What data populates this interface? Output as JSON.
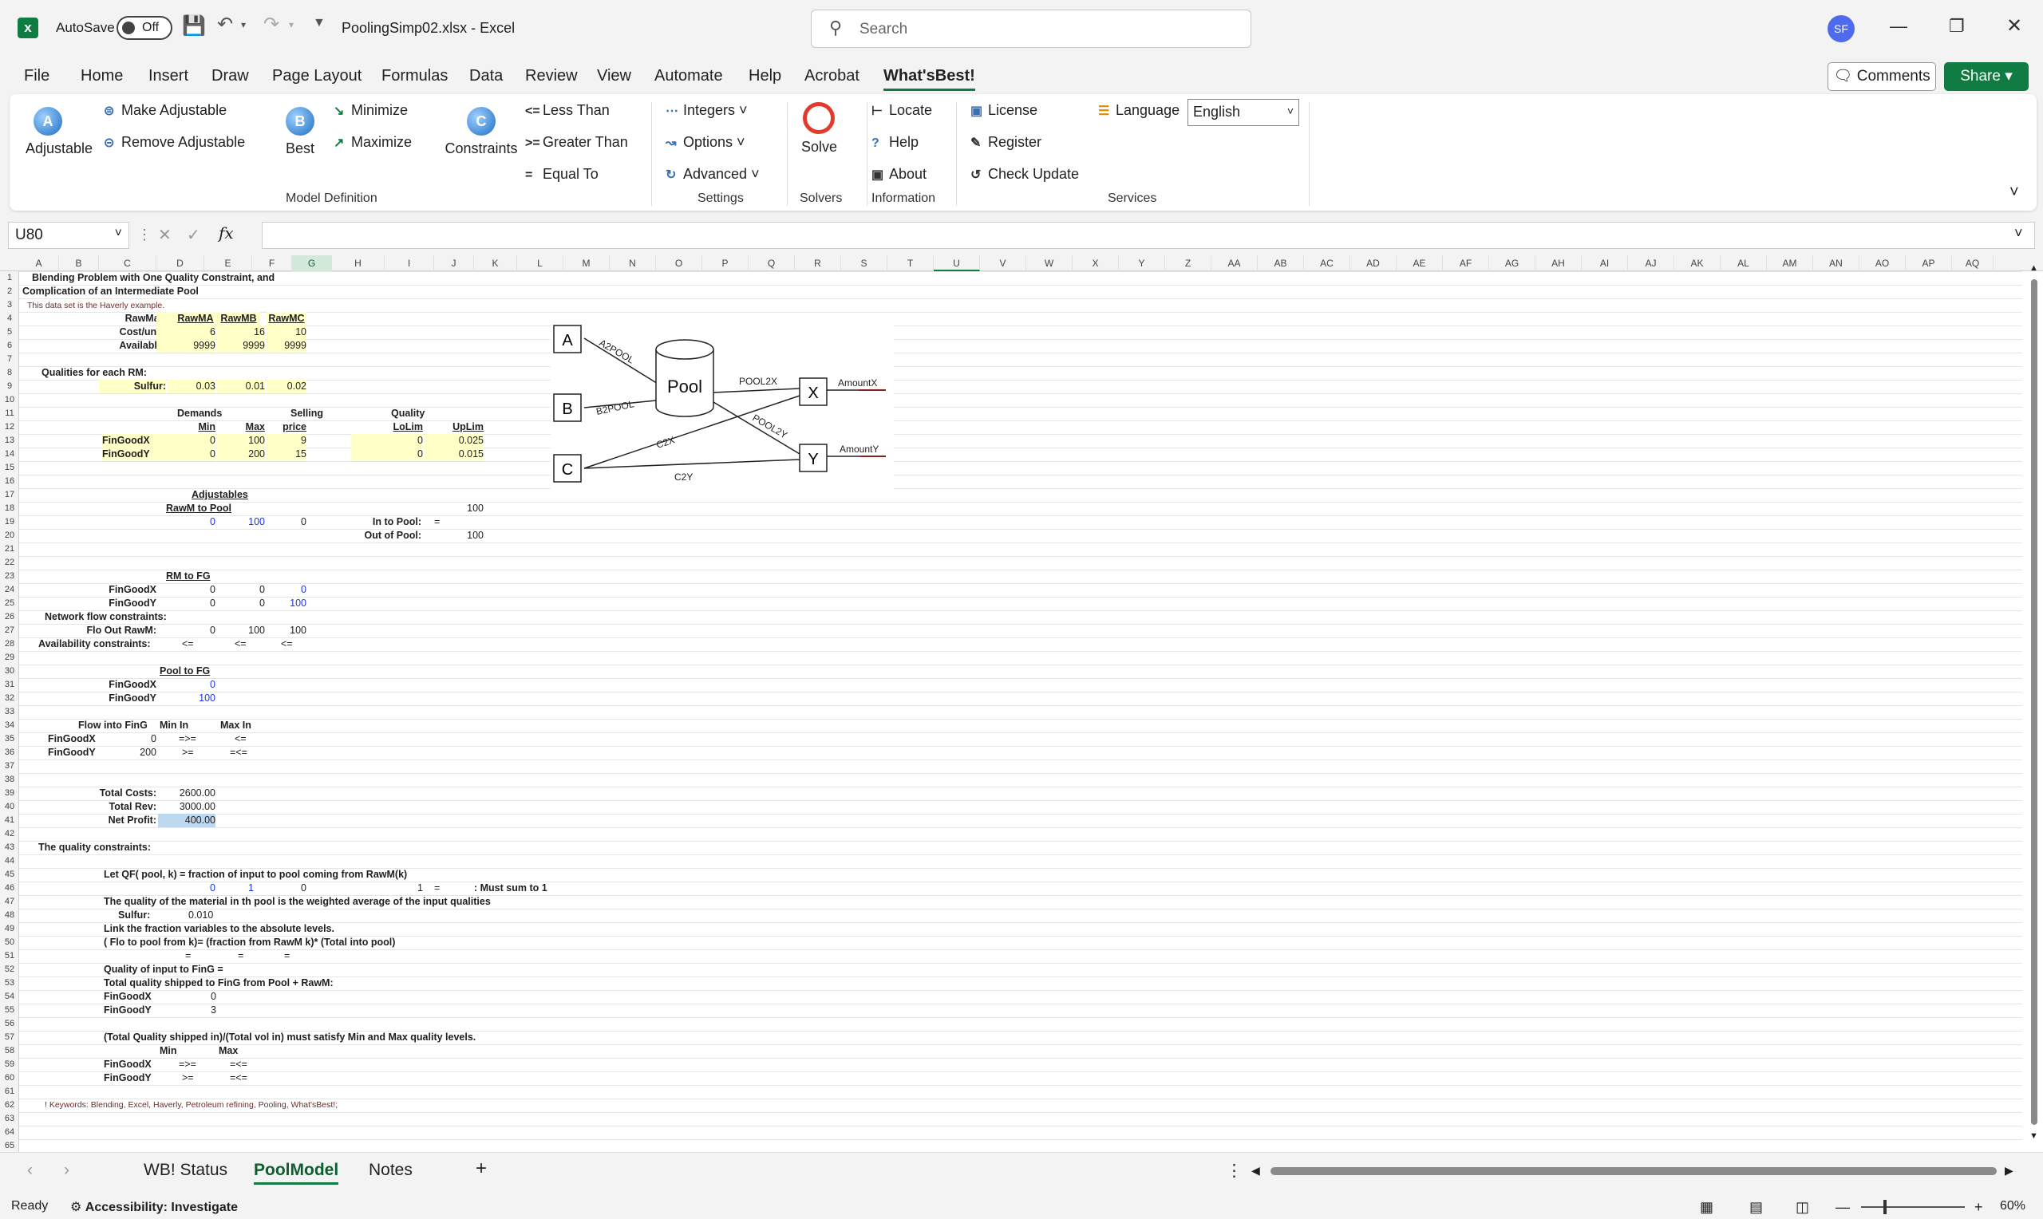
{
  "titlebar": {
    "autosave_label": "AutoSave",
    "autosave_state": "Off",
    "filename": "PoolingSimp02.xlsx  -  Excel",
    "search_placeholder": "Search",
    "user_initials": "SF"
  },
  "menu": [
    "File",
    "Home",
    "Insert",
    "Draw",
    "Page Layout",
    "Formulas",
    "Data",
    "Review",
    "View",
    "Automate",
    "Help",
    "Acrobat",
    "What'sBest!"
  ],
  "menu_active": "What'sBest!",
  "comments_label": "Comments",
  "share_label": "Share",
  "ribbon": {
    "adjustable": "Adjustable",
    "make_adjustable": "Make Adjustable",
    "remove_adjustable": "Remove Adjustable",
    "best": "Best",
    "minimize": "Minimize",
    "maximize": "Maximize",
    "constraints": "Constraints",
    "less_than": "Less Than",
    "greater_than": "Greater Than",
    "equal_to": "Equal To",
    "group_model": "Model Definition",
    "integers": "Integers",
    "options": "Options",
    "advanced": "Advanced",
    "group_settings": "Settings",
    "solve": "Solve",
    "group_solvers": "Solvers",
    "locate": "Locate",
    "help": "Help",
    "about": "About",
    "group_information": "Information",
    "license": "License",
    "register": "Register",
    "check_update": "Check Update",
    "language": "Language",
    "language_value": "English",
    "group_services": "Services"
  },
  "namebox": "U80",
  "columns": [
    "A",
    "B",
    "C",
    "D",
    "E",
    "F",
    "G",
    "H",
    "I",
    "J",
    "K",
    "L",
    "M",
    "N",
    "O",
    "P",
    "Q",
    "R",
    "S",
    "T",
    "U",
    "V",
    "W",
    "X",
    "Y",
    "Z",
    "AA",
    "AB",
    "AC",
    "AD",
    "AE",
    "AF",
    "AG",
    "AH",
    "AI",
    "AJ",
    "AK",
    "AL",
    "AM",
    "AN",
    "AO",
    "AP",
    "AQ"
  ],
  "rows": 65,
  "sheet": {
    "r1": "Blending Problem with One Quality Constraint, and",
    "r2": "Complication of an Intermediate Pool",
    "r3": "This data set is the Haverly example.",
    "rawmat": "RawMat:",
    "rawma": "RawMA",
    "rawmb": "RawMB",
    "rawmc": "RawMC",
    "costunit": "Cost/unit:",
    "cost_a": "6",
    "cost_b": "16",
    "cost_c": "10",
    "available": "Available:",
    "av_a": "9999",
    "av_b": "9999",
    "av_c": "9999",
    "qualities": "Qualities for each RM:",
    "sulfur": "Sulfur:",
    "s_a": "0.03",
    "s_b": "0.01",
    "s_c": "0.02",
    "demands": "Demands",
    "selling": "Selling",
    "quality": "Quality",
    "min": "Min",
    "max": "Max",
    "price": "price",
    "lolim": "LoLim",
    "uplim": "UpLim",
    "fgx": "FinGoodX",
    "fgx_min": "0",
    "fgx_max": "100",
    "fgx_price": "9",
    "fgx_lo": "0",
    "fgx_up": "0.025",
    "fgy": "FinGoodY",
    "fgy_min": "0",
    "fgy_max": "200",
    "fgy_price": "15",
    "fgy_lo": "0",
    "fgy_up": "0.015",
    "adjustables": "Adjustables",
    "rawm_to_pool": "RawM to Pool",
    "i17": "100",
    "p_a": "0",
    "p_b": "100",
    "p_c": "0",
    "in_to_pool": "In to Pool:",
    "eq": "=",
    "out_of_pool": "Out of Pool:",
    "out_val": "100",
    "rm_to_fg": "RM to FG",
    "rx_a": "0",
    "rx_b": "0",
    "rx_c": "0",
    "ry_a": "0",
    "ry_b": "0",
    "ry_c": "100",
    "network": "Network flow constraints:",
    "flo_out": "Flo Out RawM:",
    "fo_a": "0",
    "fo_b": "100",
    "fo_c": "100",
    "avail_con": "Availability constraints:",
    "le": "<=",
    "pool_to_fg": "Pool to FG",
    "pfx": "0",
    "pfy": "100",
    "flow_into": "Flow into FinG",
    "min_in": "Min In",
    "max_in": "Max In",
    "fx_val": "0",
    "fy_val": "200",
    "geq": "=>=",
    "ge": ">=",
    "leq": "<=",
    "eleq": "=<=",
    "total_costs": "Total Costs:",
    "tc": "2600.00",
    "total_rev": "Total Rev:",
    "tr": "3000.00",
    "net_profit": "Net Profit:",
    "np": "400.00",
    "quality_con": "The quality constraints:",
    "r45": "Let QF( pool, k) = fraction of input to pool coming from RawM(k)",
    "qf_a": "0",
    "qf_b": "1",
    "qf_c": "0",
    "qf_sum": "1",
    "must_sum": ": Must sum to 1",
    "r47": "The quality of the material in th pool is the weighted average of the input qualities",
    "sulfur48": "Sulfur:",
    "sulfur48_val": "0.010",
    "r49": "Link the fraction variables to the absolute levels.",
    "r50": "( Flo to pool from k)= (fraction from RawM k)* (Total into pool)",
    "r52": "Quality of input to  FinG =",
    "r53": "Total quality shipped to FinG from Pool + RawM:",
    "q54": "0",
    "q55": "3",
    "r57": "(Total Quality shipped in)/(Total vol in) must satisfy Min and Max  quality levels.",
    "min58": "Min",
    "max58": "Max",
    "r62": "! Keywords: Blending, Excel, Haverly, Petroleum refining, Pooling, What'sBest!;"
  },
  "diagram": {
    "a": "A",
    "b": "B",
    "c": "C",
    "x": "X",
    "y": "Y",
    "pool": "Pool",
    "a2pool": "A2POOL",
    "b2pool": "B2POOL",
    "pool2x": "POOL2X",
    "pool2y": "POOL2Y",
    "c2x": "C2X",
    "c2y": "C2Y",
    "amountx": "AmountX",
    "amounty": "AmountY"
  },
  "tabs": [
    "WB! Status",
    "PoolModel",
    "Notes"
  ],
  "status": {
    "ready": "Ready",
    "accessibility": "Accessibility: Investigate",
    "zoom": "60%"
  }
}
